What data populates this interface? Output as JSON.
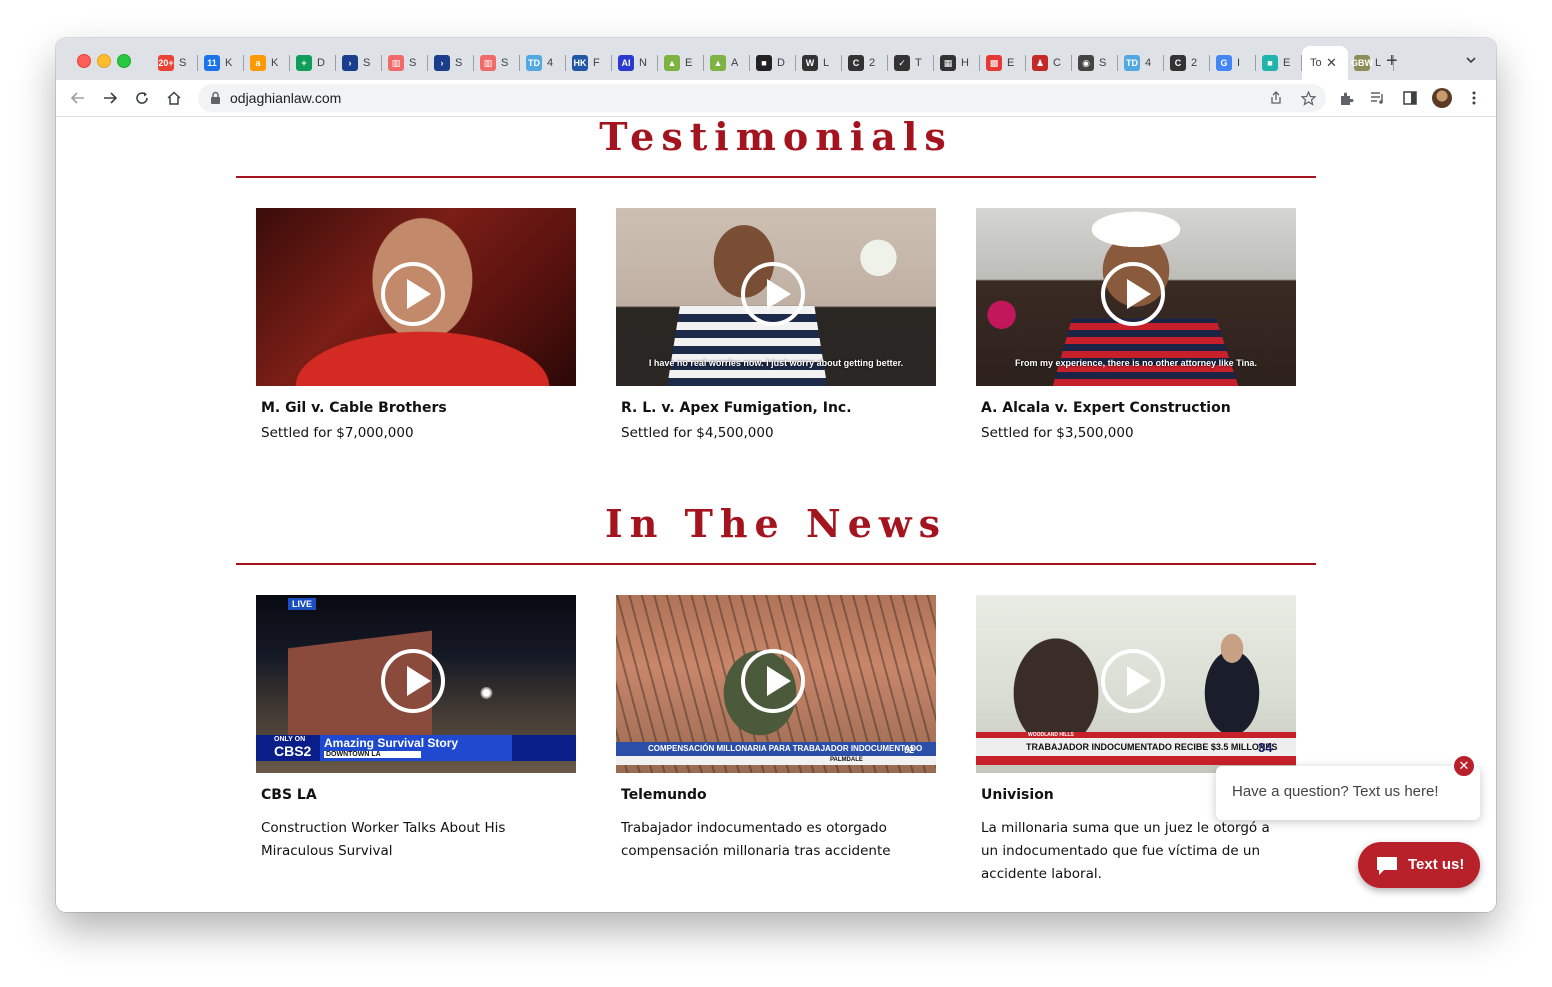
{
  "browser": {
    "tabs": [
      {
        "icon": "gmail-icon",
        "title": "S",
        "badge": "20+",
        "color": "#ea4335"
      },
      {
        "icon": "calendar-icon",
        "title": "K",
        "badge": "11",
        "color": "#1a73e8"
      },
      {
        "icon": "amazon-icon",
        "title": "K",
        "badge": "a",
        "color": "#ff9900"
      },
      {
        "icon": "sheets-icon",
        "title": "D",
        "badge": "+",
        "color": "#0f9d58"
      },
      {
        "icon": "chevron-app-icon",
        "title": "S",
        "badge": "›",
        "color": "#1a3e8c"
      },
      {
        "icon": "analytics-icon",
        "title": "S",
        "badge": "▥",
        "color": "#f06a6a"
      },
      {
        "icon": "chevron-app-icon",
        "title": "S",
        "badge": "›",
        "color": "#1a3e8c"
      },
      {
        "icon": "analytics-icon",
        "title": "S",
        "badge": "▥",
        "color": "#f06a6a"
      },
      {
        "icon": "td-icon",
        "title": "4",
        "badge": "TD",
        "color": "#52a8e0"
      },
      {
        "icon": "hk-icon",
        "title": "F",
        "badge": "HK",
        "color": "#2257a8"
      },
      {
        "icon": "ai-icon",
        "title": "N",
        "badge": "AI",
        "color": "#2a3ad0"
      },
      {
        "icon": "image-icon",
        "title": "E",
        "badge": "▲",
        "color": "#7cb342"
      },
      {
        "icon": "image-icon",
        "title": "A",
        "badge": "▲",
        "color": "#7cb342"
      },
      {
        "icon": "document-icon",
        "title": "D",
        "badge": "■",
        "color": "#222222"
      },
      {
        "icon": "wikipedia-icon",
        "title": "L",
        "badge": "W",
        "color": "#333333"
      },
      {
        "icon": "c-icon",
        "title": "2",
        "badge": "C",
        "color": "#333333"
      },
      {
        "icon": "check-icon",
        "title": "T",
        "badge": "✓",
        "color": "#333333"
      },
      {
        "icon": "grid-icon",
        "title": "H",
        "badge": "▦",
        "color": "#333333"
      },
      {
        "icon": "colorful-icon",
        "title": "E",
        "badge": "▩",
        "color": "#e53935"
      },
      {
        "icon": "person-icon",
        "title": "C",
        "badge": "♟",
        "color": "#c62828"
      },
      {
        "icon": "globe-icon",
        "title": "S",
        "badge": "◉",
        "color": "#444444"
      },
      {
        "icon": "td-icon",
        "title": "4",
        "badge": "TD",
        "color": "#52a8e0"
      },
      {
        "icon": "c-icon",
        "title": "2",
        "badge": "C",
        "color": "#333333"
      },
      {
        "icon": "google-icon",
        "title": "I",
        "badge": "G",
        "color": "#4285f4"
      },
      {
        "icon": "teal-icon",
        "title": "E",
        "badge": "■",
        "color": "#1fb5ac"
      },
      {
        "icon": "active-tab-icon",
        "title": "To",
        "badge": "",
        "color": "#ffffff",
        "active": true
      },
      {
        "icon": "gbw-icon",
        "title": "L",
        "badge": "GBW",
        "color": "#8d8d5a"
      }
    ],
    "url": "odjaghianlaw.com"
  },
  "testimonials": {
    "title": "Testimonials",
    "cards": [
      {
        "title": "M. Gil v. Cable Brothers",
        "subtitle": "Settled for $7,000,000",
        "caption": ""
      },
      {
        "title": "R. L. v. Apex Fumigation, Inc.",
        "subtitle": "Settled for $4,500,000",
        "caption": "I have no real worries now. I just worry about getting better."
      },
      {
        "title": "A. Alcala v. Expert Construction",
        "subtitle": "Settled for $3,500,000",
        "caption": "From my experience, there is no other attorney like Tina."
      }
    ]
  },
  "news": {
    "title": "In The News",
    "cards": [
      {
        "title": "CBS LA",
        "description": "Construction Worker Talks About His Miraculous Survival",
        "badge": "LIVE",
        "banner": "Amazing Survival Story",
        "banner_sub": "DOWNTOWN LA",
        "channel": "CBS2",
        "channel_tag": "ONLY ON"
      },
      {
        "title": "Telemundo",
        "description": "Trabajador indocumentado es otorgado compensación millonaria tras accidente",
        "banner": "COMPENSACIÓN MILLONARIA PARA TRABAJADOR INDOCUMENTADO",
        "banner_sub": "PALMDALE",
        "channel": "52"
      },
      {
        "title": "Univision",
        "description": "La millonaria suma que un juez le otorgó a un indocumentado que fue víctima de un accidente laboral.",
        "banner": "TRABAJADOR INDOCUMENTADO RECIBE $3.5 MILLONES",
        "banner_sub": "WOODLAND HILLS",
        "channel": "34"
      }
    ]
  },
  "chat": {
    "prompt": "Have a question? Text us here!",
    "close_label": "✕",
    "button_label": "Text us!"
  },
  "colors": {
    "brand_red": "#a4141f",
    "chat_red": "#b8202a"
  }
}
